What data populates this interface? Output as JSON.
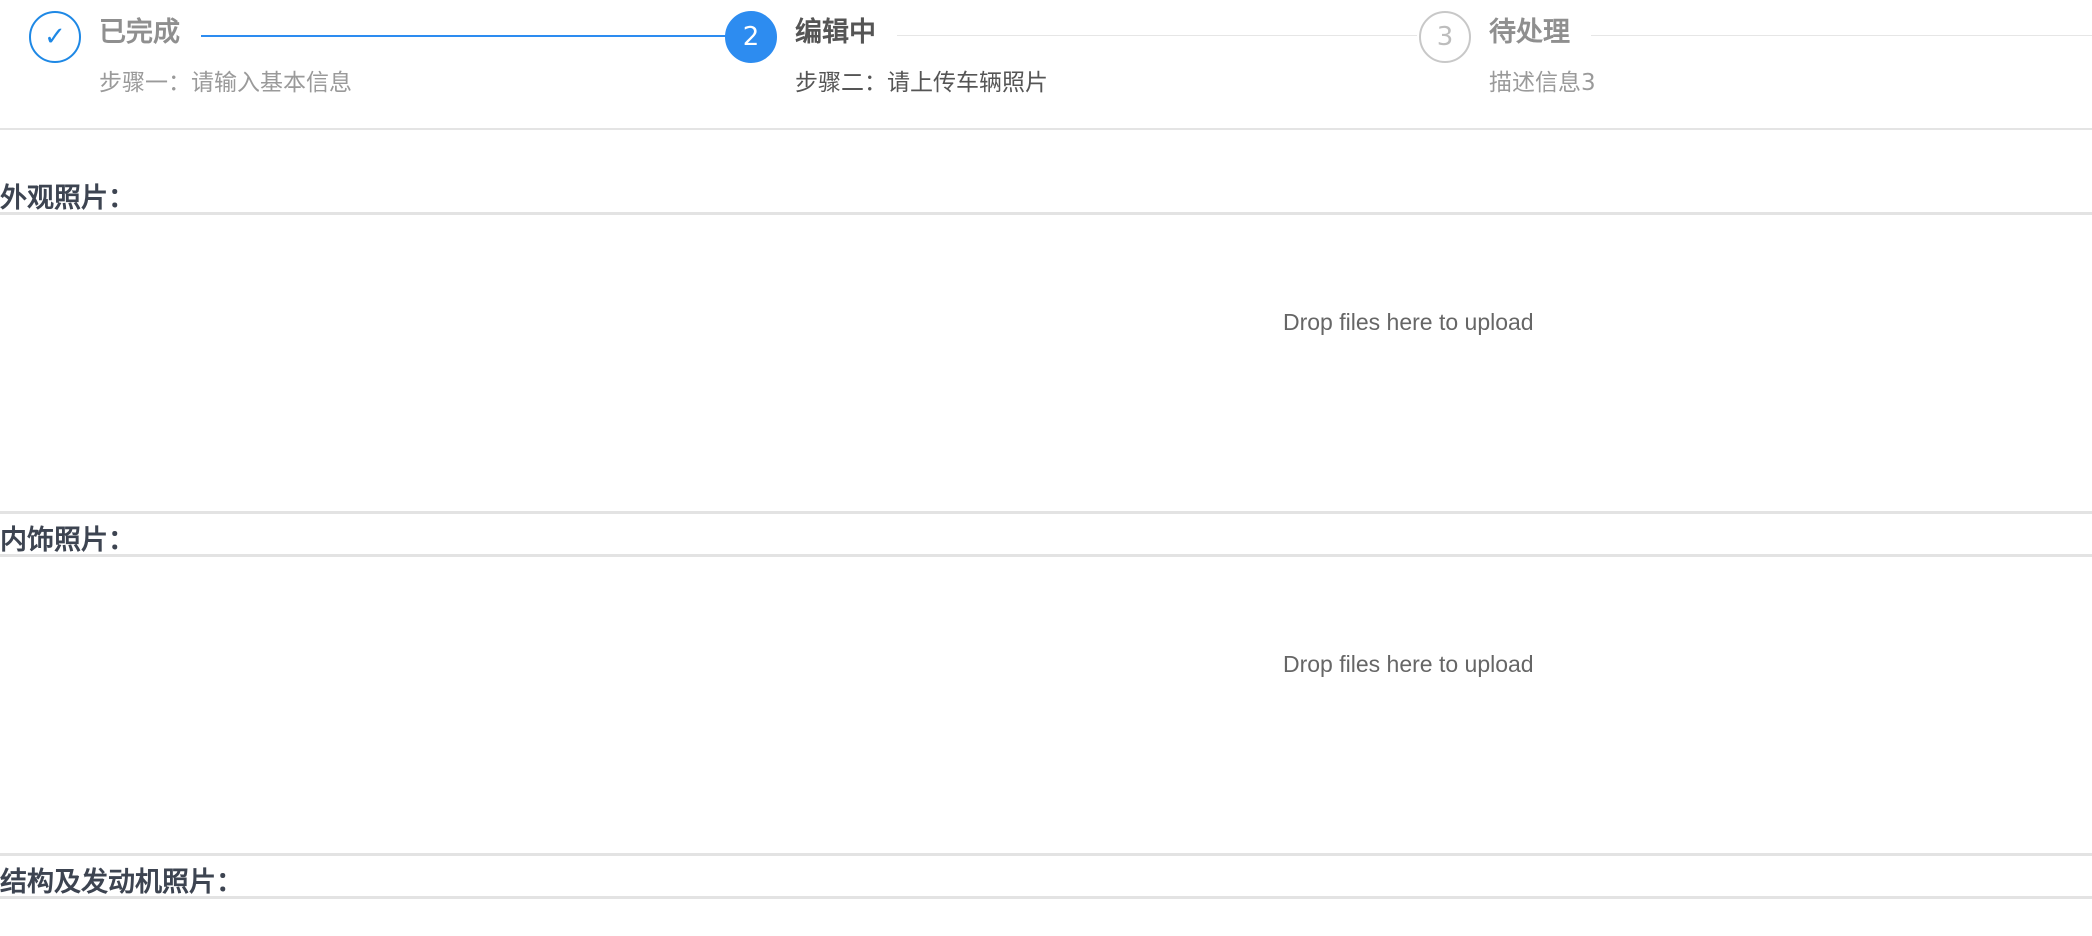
{
  "steps": [
    {
      "status": "done",
      "icon": "check-icon",
      "symbol": "✓",
      "title": "已完成",
      "description": "步骤一：请输入基本信息"
    },
    {
      "status": "active",
      "number": "2",
      "title": "编辑中",
      "description": "步骤二：请上传车辆照片"
    },
    {
      "status": "wait",
      "number": "3",
      "title": "待处理",
      "description": "描述信息3"
    }
  ],
  "sections": [
    {
      "title": "外观照片：",
      "upload_message": "Drop files here to upload"
    },
    {
      "title": "内饰照片：",
      "upload_message": "Drop files here to upload"
    },
    {
      "title": "结构及发动机照片："
    }
  ],
  "colors": {
    "primary": "#2d8cf0",
    "done_border": "#1e88e5",
    "wait_border": "#c8c8c8",
    "section_title": "#3d4451",
    "divider": "#e3e3e3"
  }
}
